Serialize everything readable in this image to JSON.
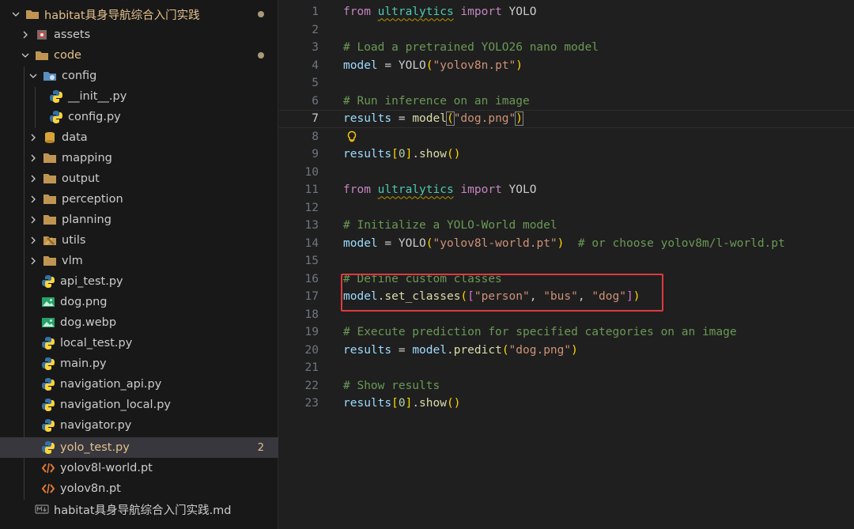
{
  "explorer": {
    "root_folder": "habitat具身导航综合入门实践",
    "items": [
      {
        "label": "assets"
      },
      {
        "label": "code"
      },
      {
        "label": "config"
      },
      {
        "label": "__init__.py"
      },
      {
        "label": "config.py"
      },
      {
        "label": "data"
      },
      {
        "label": "mapping"
      },
      {
        "label": "output"
      },
      {
        "label": "perception"
      },
      {
        "label": "planning"
      },
      {
        "label": "utils"
      },
      {
        "label": "vlm"
      },
      {
        "label": "api_test.py"
      },
      {
        "label": "dog.png"
      },
      {
        "label": "dog.webp"
      },
      {
        "label": "local_test.py"
      },
      {
        "label": "main.py"
      },
      {
        "label": "navigation_api.py"
      },
      {
        "label": "navigation_local.py"
      },
      {
        "label": "navigator.py"
      },
      {
        "label": "yolo_test.py",
        "badge": "2"
      },
      {
        "label": "yolov8l-world.pt"
      },
      {
        "label": "yolov8n.pt"
      },
      {
        "label": "habitat具身导航综合入门实践.md"
      }
    ]
  },
  "editor": {
    "current_line": 7,
    "line_numbers": [
      "1",
      "2",
      "3",
      "4",
      "5",
      "6",
      "7",
      "8",
      "9",
      "10",
      "11",
      "12",
      "13",
      "14",
      "15",
      "16",
      "17",
      "18",
      "19",
      "20",
      "21",
      "22",
      "23"
    ],
    "code": {
      "l1": {
        "kw1": "from",
        "mod": "ultralytics",
        "kw2": "import",
        "name": "YOLO"
      },
      "l3": "# Load a pretrained YOLO26 nano model",
      "l4": {
        "var": "model",
        "eq": " = ",
        "cls": "YOLO",
        "open": "(",
        "str": "\"yolov8n.pt\"",
        "close": ")"
      },
      "l6": "# Run inference on an image",
      "l7": {
        "var": "results",
        "eq": " = ",
        "fn": "model",
        "open": "(",
        "str": "\"dog.png\"",
        "close": ")"
      },
      "l9": {
        "var": "results",
        "b1": "[",
        "num": "0",
        "b2": "]",
        "dot": ".",
        "fn": "show",
        "paren": "()"
      },
      "l11": {
        "kw1": "from",
        "mod": "ultralytics",
        "kw2": "import",
        "name": "YOLO"
      },
      "l13": "# Initialize a YOLO-World model",
      "l14": {
        "var": "model",
        "eq": " = ",
        "cls": "YOLO",
        "open": "(",
        "str": "\"yolov8l-world.pt\"",
        "close": ")",
        "comment": "# or choose yolov8m/l-world.pt"
      },
      "l16": "# Define custom classes",
      "l17": {
        "var": "model",
        "dot": ".",
        "fn": "set_classes",
        "open": "(",
        "lb": "[",
        "s1": "\"person\"",
        "c1": ", ",
        "s2": "\"bus\"",
        "c2": ", ",
        "s3": "\"dog\"",
        "rb": "]",
        "close": ")"
      },
      "l19": "# Execute prediction for specified categories on an image",
      "l20": {
        "var": "results",
        "eq": " = ",
        "obj": "model",
        "dot": ".",
        "fn": "predict",
        "open": "(",
        "str": "\"dog.png\"",
        "close": ")"
      },
      "l22": "# Show results",
      "l23": {
        "var": "results",
        "b1": "[",
        "num": "0",
        "b2": "]",
        "dot": ".",
        "fn": "show",
        "paren": "()"
      }
    }
  },
  "colors": {
    "modified": "#e2c08d",
    "highlight_box": "#e0393e",
    "python_blue": "#3572a5",
    "python_yellow": "#ffd43b",
    "folder": "#c09553"
  },
  "icons": {
    "python": "python-icon",
    "folder": "folder-icon",
    "image": "image-icon",
    "xml": "code-brackets-icon",
    "markdown": "markdown-icon"
  }
}
